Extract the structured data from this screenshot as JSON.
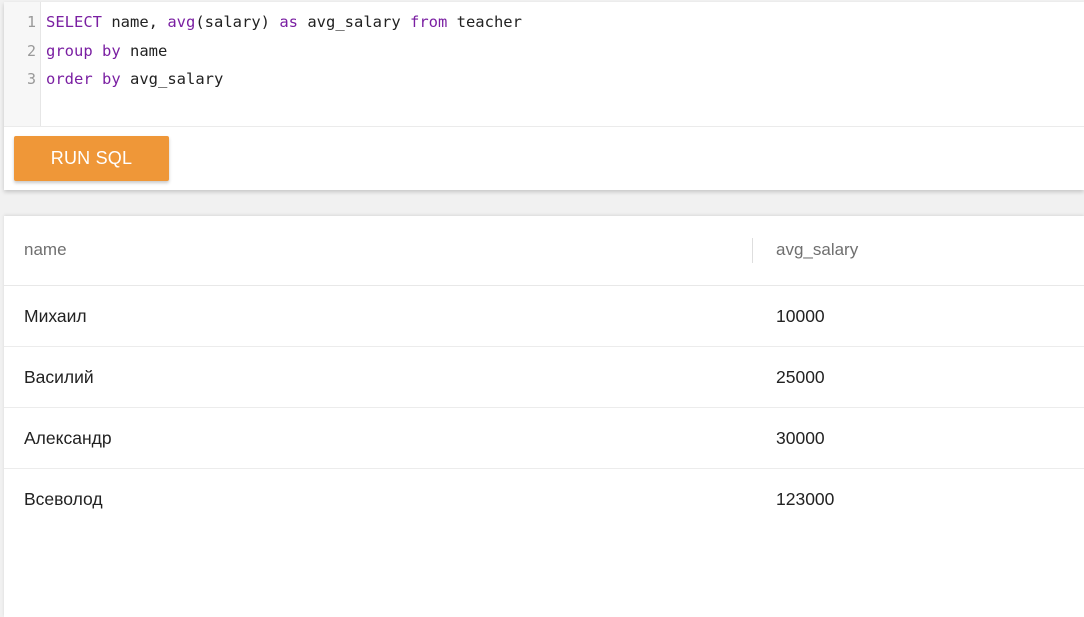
{
  "editor": {
    "line_numbers": [
      "1",
      "2",
      "3"
    ],
    "lines": [
      [
        {
          "text": "SELECT",
          "type": "kw"
        },
        {
          "text": " name, ",
          "type": "id"
        },
        {
          "text": "avg",
          "type": "fn"
        },
        {
          "text": "(salary) ",
          "type": "id"
        },
        {
          "text": "as",
          "type": "kw"
        },
        {
          "text": " avg_salary ",
          "type": "id"
        },
        {
          "text": "from",
          "type": "kw"
        },
        {
          "text": " teacher",
          "type": "id"
        }
      ],
      [
        {
          "text": "group",
          "type": "kw"
        },
        {
          "text": " ",
          "type": "id"
        },
        {
          "text": "by",
          "type": "kw"
        },
        {
          "text": " name",
          "type": "id"
        }
      ],
      [
        {
          "text": "order",
          "type": "kw"
        },
        {
          "text": " ",
          "type": "id"
        },
        {
          "text": "by",
          "type": "kw"
        },
        {
          "text": " avg_salary",
          "type": "id"
        }
      ]
    ]
  },
  "toolbar": {
    "run_label": "RUN SQL"
  },
  "results": {
    "columns": [
      "name",
      "avg_salary"
    ],
    "rows": [
      [
        "Михаил",
        "10000"
      ],
      [
        "Василий",
        "25000"
      ],
      [
        "Александр",
        "30000"
      ],
      [
        "Всеволод",
        "123000"
      ]
    ]
  },
  "colors": {
    "accent_button": "#ef9738",
    "keyword": "#7a1fa2"
  }
}
